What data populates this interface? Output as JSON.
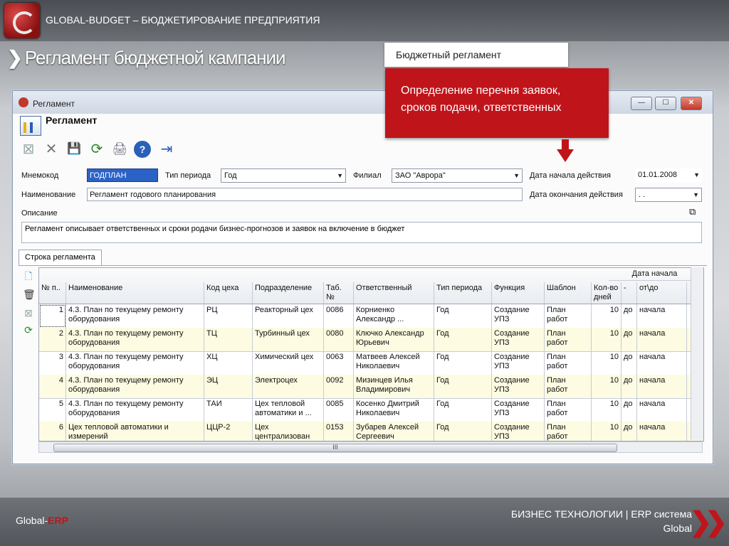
{
  "app": {
    "top_title": "GLOBAL-BUDGET – БЮДЖЕТИРОВАНИЕ ПРЕДПРИЯТИЯ",
    "heading": "Регламент бюджетной кампании",
    "heading_chev": "❯"
  },
  "callout": {
    "tab_label": "Бюджетный регламент",
    "text": "Определение перечня заявок, сроков подачи, ответственных"
  },
  "window": {
    "title": "Регламент",
    "form_title": "Регламент",
    "btn_min": "—",
    "btn_max": "☐",
    "btn_close": "✕"
  },
  "toolbar": [
    "⊠",
    "✕",
    "💾",
    "⟳",
    "🖨",
    "?",
    "⇥"
  ],
  "form": {
    "mnemo_label": "Мнемокод",
    "mnemo_value": "ГОДПЛАН",
    "period_label": "Тип периода",
    "period_value": "Год",
    "branch_label": "Филиал",
    "branch_value": "ЗАО \"Аврора\"",
    "start_label": "Дата начала действия",
    "start_value": "01.01.2008",
    "name_label": "Наименование",
    "name_value": "Регламент годового планирования",
    "end_label": "Дата окончания действия",
    "end_value": " .  .",
    "desc_label": "Описание",
    "desc_value": "Регламент описывает ответственных и сроки родачи бизнес-прогнозов и заявок на включение в бюджет",
    "dropdown_arrow": "▼"
  },
  "tab": {
    "label": "Строка регламента"
  },
  "grid": {
    "group_header": "Дата начала",
    "columns": [
      "№ п..",
      "Наименование",
      "Код цеха",
      "Подразделение",
      "Таб. №",
      "Ответственный",
      "Тип периода",
      "Функция",
      "Шаблон",
      "Кол-во дней",
      "-",
      "от\\до"
    ],
    "rows": [
      [
        "1",
        "4.3. План по текущему ремонту оборудования",
        "РЦ",
        "Реакторный цех",
        "0086",
        "Корниенко Александр ...",
        "Год",
        "Создание УПЗ",
        "План работ",
        "10",
        "до",
        "начала"
      ],
      [
        "2",
        "4.3. План по текущему ремонту оборудования",
        "ТЦ",
        "Турбинный цех",
        "0080",
        "Ключко Александр Юрьевич",
        "Год",
        "Создание УПЗ",
        "План работ",
        "10",
        "до",
        "начала"
      ],
      [
        "3",
        "4.3. План по текущему ремонту оборудования",
        "ХЦ",
        "Химический цех",
        "0063",
        "Матвеев Алексей Николаевич",
        "Год",
        "Создание УПЗ",
        "План работ",
        "10",
        "до",
        "начала"
      ],
      [
        "4",
        "4.3. План по текущему ремонту оборудования",
        "ЭЦ",
        "Электроцех",
        "0092",
        "Мизинцев Илья Владимирович",
        "Год",
        "Создание УПЗ",
        "План работ",
        "10",
        "до",
        "начала"
      ],
      [
        "5",
        "4.3. План по текущему ремонту оборудования",
        "ТАИ",
        "Цех тепловой автоматики и ...",
        "0085",
        "Косенко Дмитрий Николаевич",
        "Год",
        "Создание УПЗ",
        "План работ",
        "10",
        "до",
        "начала"
      ],
      [
        "6",
        "Цех тепловой автоматики и измерений",
        "ЦЦР-2",
        "Цех централизован",
        "0153",
        "Зубарев Алексей Сергеевич",
        "Год",
        "Создание УПЗ",
        "План работ",
        "10",
        "до",
        "начала"
      ]
    ],
    "hscroll_label": "III"
  },
  "footer": {
    "left_prefix": "Global-",
    "left_accent": "ERP",
    "right_line1": "БИЗНЕС ТЕХНОЛОГИИ | ERP система",
    "right_line2": "Global",
    "chev": "❯❯"
  },
  "colors": {
    "accent_red": "#c0141b",
    "selection_blue": "#2b62c6",
    "alt_row": "#fdfbe1"
  }
}
